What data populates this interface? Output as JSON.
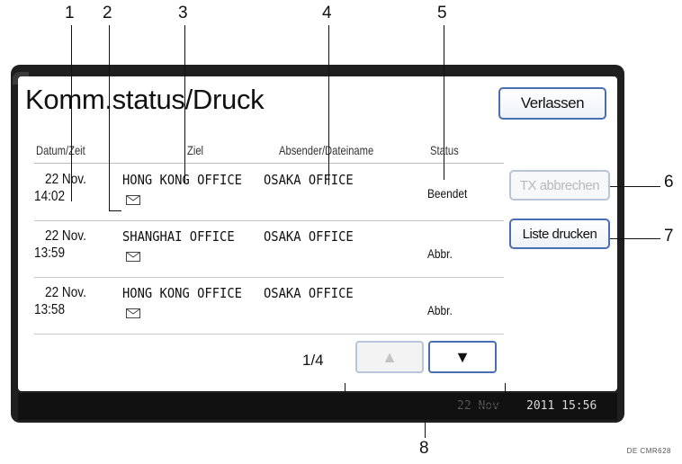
{
  "callouts": [
    "1",
    "2",
    "3",
    "4",
    "5",
    "6",
    "7",
    "8"
  ],
  "reference_code": "DE CMR628",
  "screen": {
    "title": "Komm.status/Druck",
    "exit_button": "Verlassen",
    "columns": {
      "date": "Datum/Zeit",
      "destination": "Ziel",
      "sender": "Absender/Dateiname",
      "status": "Status"
    },
    "rows": [
      {
        "date": "22 Nov.",
        "time": "14:02",
        "destination": "HONG KONG OFFICE",
        "sender": "OSAKA OFFICE",
        "status": "Beendet",
        "icon": "envelope-icon"
      },
      {
        "date": "22 Nov.",
        "time": "13:59",
        "destination": "SHANGHAI OFFICE",
        "sender": "OSAKA OFFICE",
        "status": "Abbr.",
        "icon": "envelope-icon"
      },
      {
        "date": "22 Nov.",
        "time": "13:58",
        "destination": "HONG KONG OFFICE",
        "sender": "OSAKA OFFICE",
        "status": "Abbr.",
        "icon": "envelope-icon"
      }
    ],
    "side_buttons": {
      "cancel_tx": "TX abbrechen",
      "print_list": "Liste drucken"
    },
    "pagination": {
      "page_indicator": "1/4",
      "up_arrow": "▲",
      "down_arrow": "▼"
    }
  },
  "status_bar": {
    "date": "22 Nov",
    "time": "2011 15:56"
  },
  "colors": {
    "button_border": "#4a6fb0",
    "bezel": "#1f1f1f",
    "disabled_text": "#b9b9b9"
  }
}
